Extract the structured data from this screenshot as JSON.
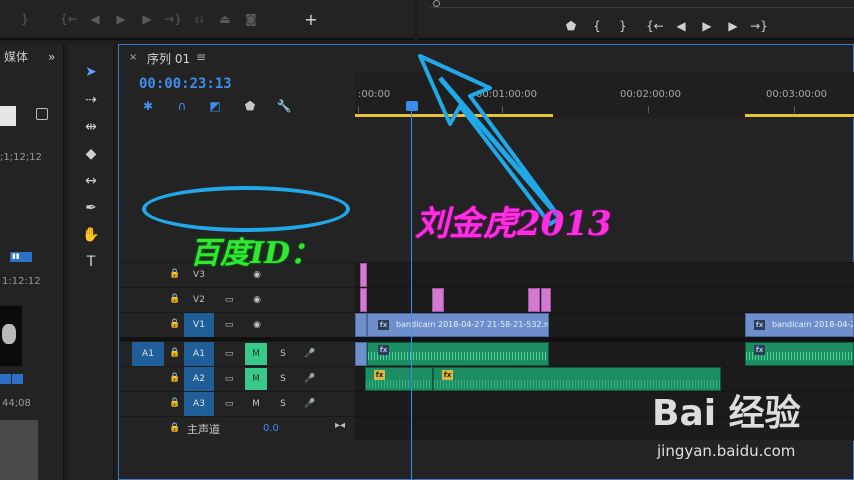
{
  "top_bar_left": {
    "buttons": [
      "}",
      "{→",
      "◀|",
      "▶",
      "|▶",
      "→}",
      "insert-icon",
      "overwrite-icon",
      "camera-icon",
      "+"
    ]
  },
  "top_bar_right": {
    "buttons": [
      "marker-icon",
      "{",
      "}",
      "{→",
      "◀|",
      "▶",
      "|▶",
      "→}"
    ]
  },
  "project_panel": {
    "tab_label": "媒体",
    "timecodes": [
      ";1;12;12",
      "1:12:12",
      "44;08"
    ]
  },
  "timeline": {
    "sequence_title": "序列 01",
    "timecode": "00:00:23:13",
    "ruler_labels": [
      ":00:00",
      "00:01:00:00",
      "00:02:00:00",
      "00:03:00:00"
    ],
    "tracks": {
      "video": [
        "V3",
        "V2",
        "V1"
      ],
      "audio": [
        "A1",
        "A2",
        "A3"
      ],
      "source_patch": "A1",
      "master_label": "主声道",
      "master_value": "0.0",
      "m_label": "M",
      "s_label": "S"
    },
    "clips": {
      "v1_clip_1": "bandicam 2018-04-27 21-58-21-532.m",
      "v1_clip_2": "bandicam 2018-04-2",
      "fx_label": "fx"
    }
  },
  "annotations": {
    "green_text": "百度ID：",
    "pink_text": "刘金虎2013",
    "accent_color": "#21a8e8"
  },
  "watermark": {
    "logo": "Bai 经验",
    "url": "jingyan.baidu.com"
  }
}
